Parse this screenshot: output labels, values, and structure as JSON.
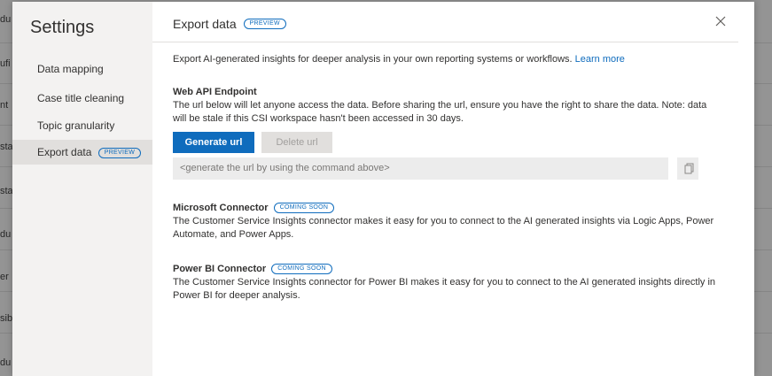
{
  "background": {
    "fragments": [
      "du",
      "ufi",
      "nt",
      "sta",
      "sta",
      "du",
      "er",
      "sib",
      "du"
    ]
  },
  "sidebar": {
    "title": "Settings",
    "items": [
      {
        "label": "Data mapping"
      },
      {
        "label": "Case title cleaning"
      },
      {
        "label": "Topic granularity"
      },
      {
        "label": "Export data",
        "badge": "PREVIEW",
        "selected": true
      }
    ]
  },
  "header": {
    "title": "Export data",
    "badge": "PREVIEW",
    "close_icon": "close-icon"
  },
  "intro": {
    "text": "Export AI-generated insights for deeper analysis in your own reporting systems or workflows. ",
    "link": "Learn more"
  },
  "web_api": {
    "title": "Web API Endpoint",
    "description": "The url below will let anyone access the data. Before sharing the url, ensure you have the right to share the data. Note: data will be stale if this CSI workspace hasn't been accessed in 30 days.",
    "generate_label": "Generate url",
    "delete_label": "Delete url",
    "url_placeholder": "<generate the url by using the command above>",
    "copy_icon": "copy-icon"
  },
  "microsoft_connector": {
    "title": "Microsoft Connector",
    "badge": "COMING SOON",
    "description": "The Customer Service Insights connector makes it easy for you to connect to the AI generated insights via Logic Apps, Power Automate, and Power Apps."
  },
  "powerbi_connector": {
    "title": "Power BI Connector",
    "badge": "COMING SOON",
    "description": "The Customer Service Insights connector for Power BI makes it easy for you to connect to the AI generated insights directly in Power BI for deeper analysis."
  },
  "colors": {
    "accent": "#0f6cbd",
    "nav_background": "#f3f2f1",
    "nav_selected": "#e1dfdd"
  }
}
